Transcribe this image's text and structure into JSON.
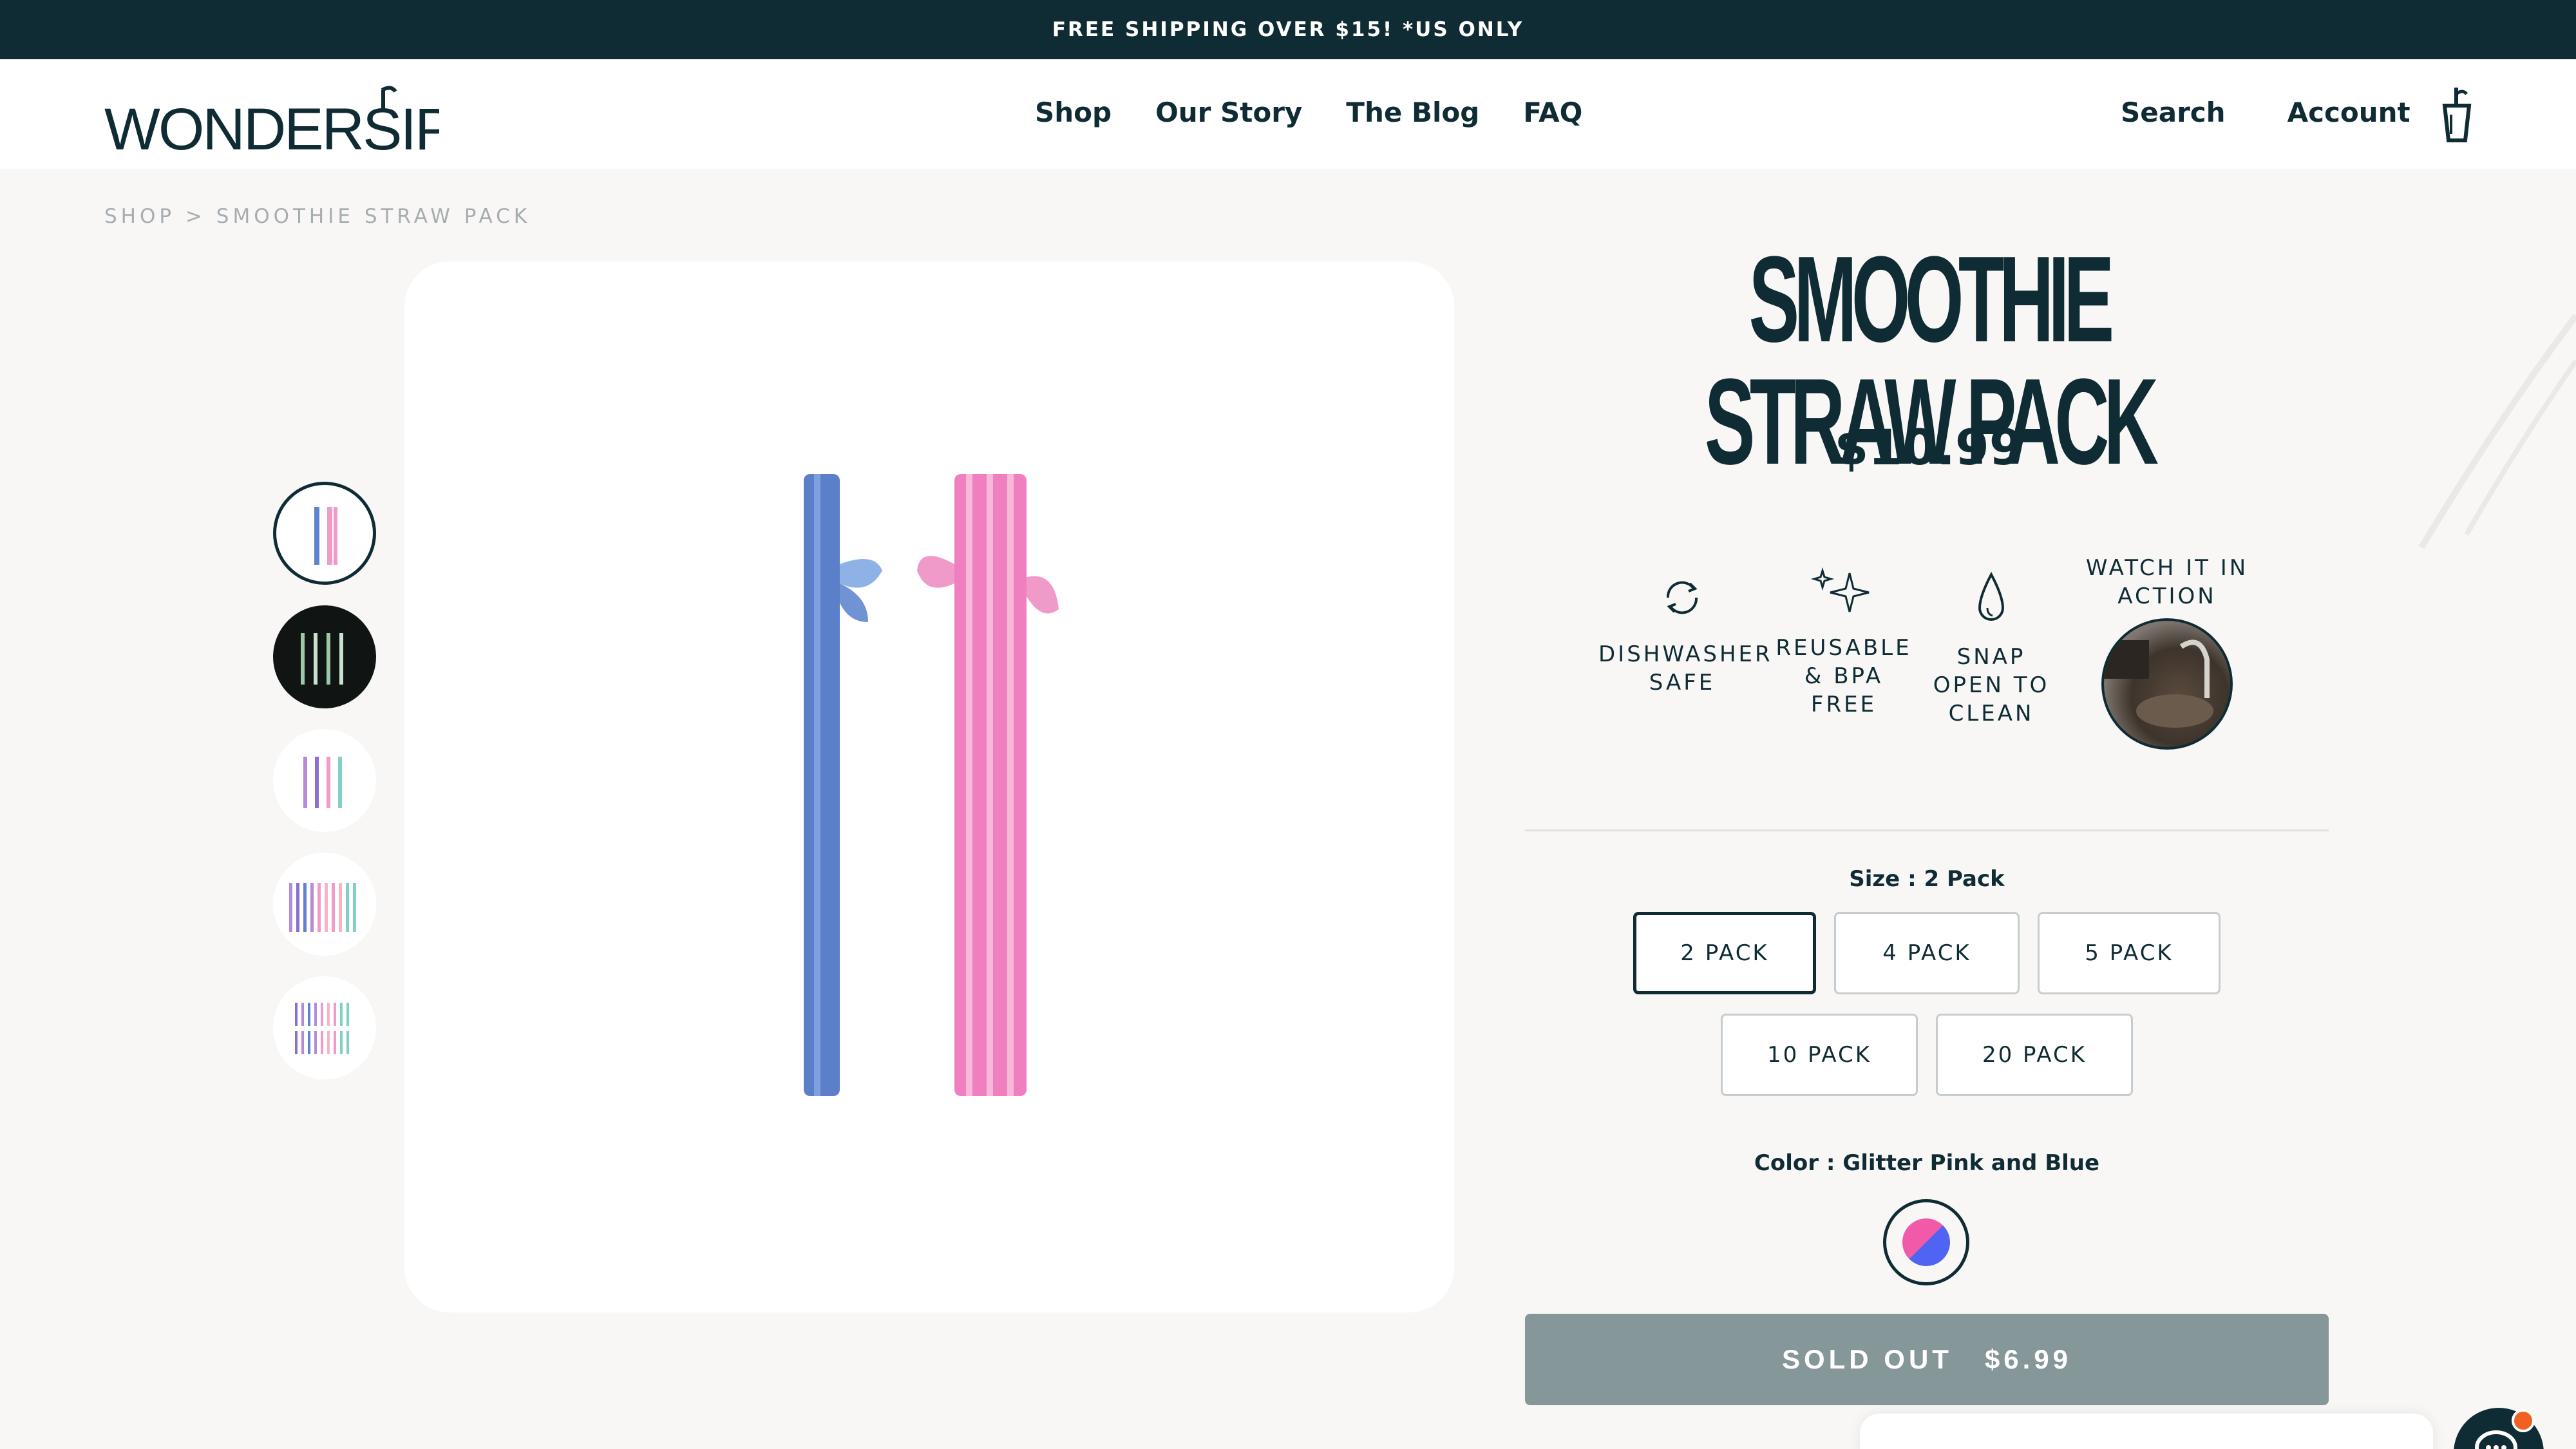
{
  "announcement": "FREE SHIPPING OVER $15! *US ONLY",
  "logo": "WONDERSIP",
  "nav": [
    "Shop",
    "Our Story",
    "The Blog",
    "FAQ"
  ],
  "utility": {
    "search": "Search",
    "account": "Account",
    "cart_icon": "cup-cart-icon"
  },
  "breadcrumb": "SHOP > SMOOTHIE STRAW PACK",
  "product": {
    "title": "SMOOTHIE STRAW PACK",
    "price": "$10.99"
  },
  "features": [
    {
      "label_lines": [
        "DISHWASHER",
        "SAFE"
      ],
      "icon": "refresh-icon"
    },
    {
      "label_lines": [
        "REUSABLE",
        "& BPA",
        "FREE"
      ],
      "icon": "sparkle-icon"
    },
    {
      "label_lines": [
        "SNAP",
        "OPEN TO",
        "CLEAN"
      ],
      "icon": "droplet-icon"
    },
    {
      "label_lines": [
        "WATCH IT IN",
        "ACTION"
      ],
      "icon": "video-thumbnail"
    }
  ],
  "size": {
    "label": "Size : 2 Pack",
    "options": [
      "2 PACK",
      "4 PACK",
      "5 PACK",
      "10 PACK",
      "20 PACK"
    ],
    "selected": "2 PACK"
  },
  "color": {
    "label": "Color : Glitter Pink and Blue",
    "swatch_colors": [
      "#f05aa8",
      "#4f64f2"
    ]
  },
  "cta": {
    "status": "SOLD OUT",
    "price": "$6.99"
  },
  "colors": {
    "brand": "#0f2c35",
    "background": "#f8f7f5",
    "soldout": "#869799",
    "accent": "#f0601e"
  }
}
